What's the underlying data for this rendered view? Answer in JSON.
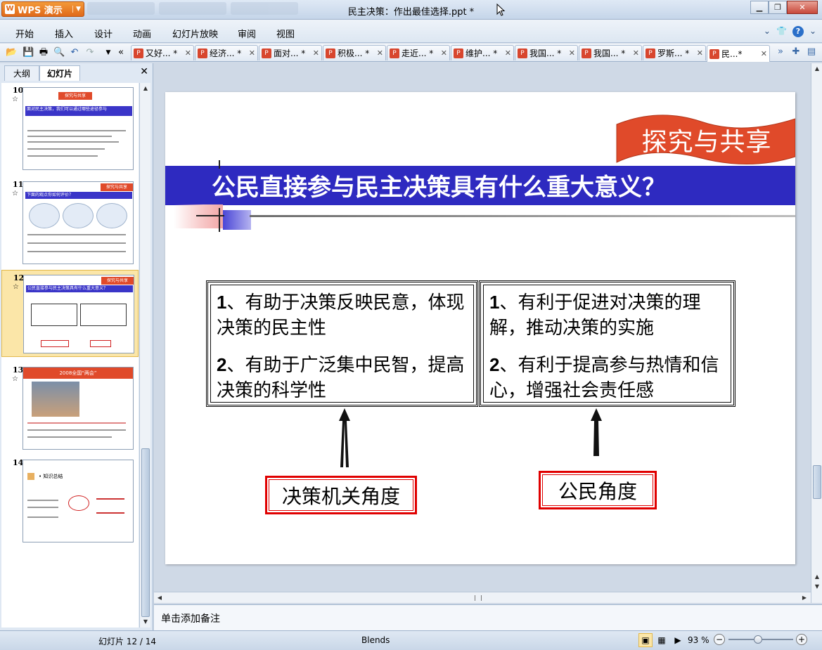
{
  "app": {
    "brand": "WPS 演示",
    "window_title": "民主决策：作出最佳选择.ppt *"
  },
  "menu": [
    "开始",
    "插入",
    "设计",
    "动画",
    "幻灯片放映",
    "审阅",
    "视图"
  ],
  "doc_tabs": [
    {
      "label": "又好... *",
      "active": false
    },
    {
      "label": "经济... *",
      "active": false
    },
    {
      "label": "面对... *",
      "active": false
    },
    {
      "label": "积极... *",
      "active": false
    },
    {
      "label": "走近... *",
      "active": false
    },
    {
      "label": "维护... *",
      "active": false
    },
    {
      "label": "我国... *",
      "active": false
    },
    {
      "label": "我国... *",
      "active": false
    },
    {
      "label": "罗斯... *",
      "active": false
    },
    {
      "label": "民...*",
      "active": true
    }
  ],
  "left_panel": {
    "tabs": [
      "大纲",
      "幻灯片"
    ],
    "active_tab": "幻灯片",
    "slides": [
      {
        "num": "10",
        "ribbon": "探究与共享",
        "title": "面对民主决策，我们可以通过哪些途径参与"
      },
      {
        "num": "11",
        "ribbon": "探究与共享",
        "title": "下面的观点你如何评价？"
      },
      {
        "num": "12",
        "ribbon": "探究与共享",
        "title": "公民直接参与民主决策具有什么重大意义？",
        "selected": true
      },
      {
        "num": "13",
        "ribbon": "2008全国“两会”",
        "title": ""
      },
      {
        "num": "14",
        "ribbon": "",
        "title": "• 知识总结"
      }
    ]
  },
  "slide": {
    "ribbon_text": "探究与共享",
    "title": "公民直接参与民主决策具有什么重大意义？",
    "left_box": [
      {
        "num": "1",
        "text": "、有助于决策反映民意，体现决策的民主性"
      },
      {
        "num": "2",
        "text": "、有助于广泛集中民智，提高决策的科学性"
      }
    ],
    "right_box": [
      {
        "num": "1",
        "text": "、有利于促进对决策的理解，推动决策的实施"
      },
      {
        "num": "2",
        "text": "、有利于提高参与热情和信心，增强社会责任感"
      }
    ],
    "left_label": "决策机关角度",
    "right_label": "公民角度"
  },
  "notes_placeholder": "单击添加备注",
  "status": {
    "slide_position": "幻灯片 12 / 14",
    "theme": "Blends",
    "zoom": "93 %"
  },
  "colors": {
    "title_band": "#2e2ac0",
    "ribbon": "#e04a2a",
    "label_border": "#e00000",
    "selected_thumb": "#fbe6a8"
  }
}
